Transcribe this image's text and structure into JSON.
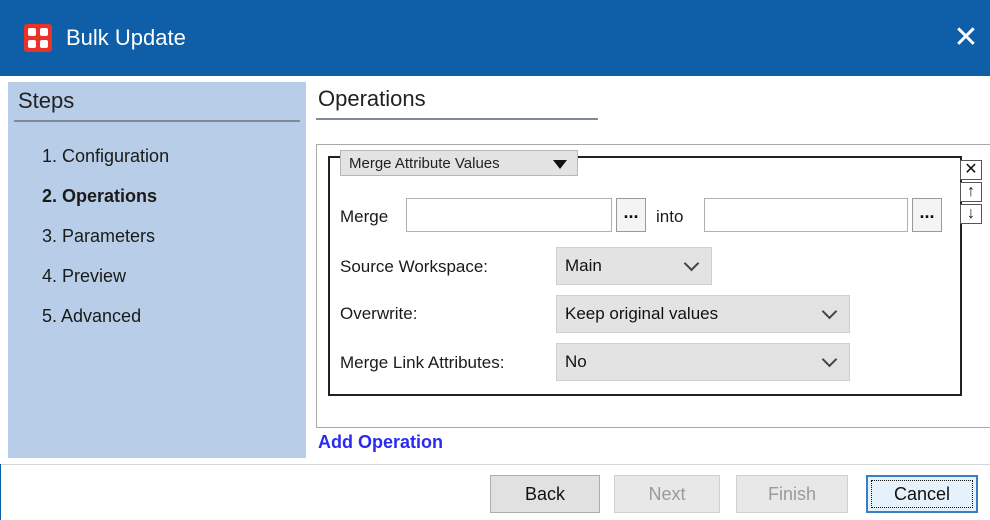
{
  "window": {
    "title": "Bulk Update",
    "close_glyph": "✕"
  },
  "steps": {
    "title": "Steps",
    "items": [
      {
        "label": "1. Configuration",
        "active": false
      },
      {
        "label": "2. Operations",
        "active": true
      },
      {
        "label": "3. Parameters",
        "active": false
      },
      {
        "label": "4. Preview",
        "active": false
      },
      {
        "label": "5. Advanced",
        "active": false
      }
    ]
  },
  "content": {
    "title": "Operations",
    "operation": {
      "type": "Merge Attribute Values",
      "side_buttons": {
        "remove": "✕",
        "up": "↑",
        "down": "↓"
      },
      "merge_label": "Merge",
      "merge_value": "",
      "into_label": "into",
      "into_value": "",
      "browse_label": "...",
      "source_workspace": {
        "label": "Source Workspace:",
        "value": "Main"
      },
      "overwrite": {
        "label": "Overwrite:",
        "value": "Keep original values"
      },
      "merge_link_attributes": {
        "label": "Merge Link Attributes:",
        "value": "No"
      }
    },
    "add_operation": "Add Operation"
  },
  "footer": {
    "back": "Back",
    "next": "Next",
    "finish": "Finish",
    "cancel": "Cancel"
  },
  "colors": {
    "titlebar": "#0e5ea8",
    "steps_panel": "#b7cde8",
    "link": "#2a2af0",
    "app_icon": "#e8322a"
  }
}
